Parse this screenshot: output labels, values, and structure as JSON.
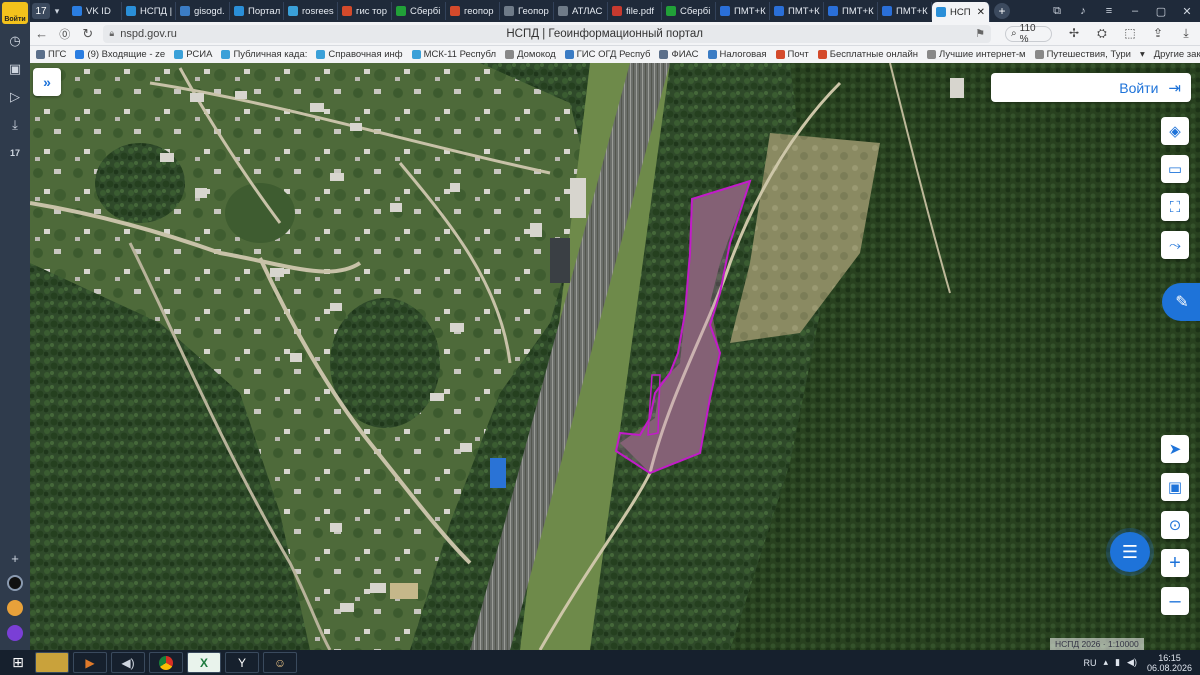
{
  "sidebar": {
    "login_label": "Войти",
    "tab_count": "17"
  },
  "tabs": [
    {
      "label": "VK ID",
      "color": "#2a7de1"
    },
    {
      "label": "НСПД |",
      "color": "#2a8fd8"
    },
    {
      "label": "gisogd.",
      "color": "#3b7cc4"
    },
    {
      "label": "Портал",
      "color": "#2a8fd8"
    },
    {
      "label": "rosrees",
      "color": "#3aa0d8"
    },
    {
      "label": "гис тор",
      "color": "#d44a2b"
    },
    {
      "label": "Сбербі",
      "color": "#21a038"
    },
    {
      "label": "геопор",
      "color": "#d44a2b"
    },
    {
      "label": "Геопор",
      "color": "#6f7b88"
    },
    {
      "label": "АТЛАС",
      "color": "#6f7b88"
    },
    {
      "label": "file.pdf",
      "color": "#c73a2f"
    },
    {
      "label": "Сбербі",
      "color": "#21a038"
    },
    {
      "label": "ПМТ+К",
      "color": "#2a6fd8"
    },
    {
      "label": "ПМТ+К",
      "color": "#2a6fd8"
    },
    {
      "label": "ПМТ+К",
      "color": "#2a6fd8"
    },
    {
      "label": "ПМТ+К",
      "color": "#2a6fd8"
    }
  ],
  "active_tab": {
    "label": "НСП",
    "close": "✕"
  },
  "address": {
    "url": "nspd.gov.ru",
    "title": "НСПД | Геоинформационный портал",
    "zoom": "110 %"
  },
  "bookmarks": [
    {
      "label": "ПГС",
      "color": "#5b6f8a"
    },
    {
      "label": "(9) Входящие - ze",
      "color": "#2a7de1"
    },
    {
      "label": "РСИА",
      "color": "#3aa0d8"
    },
    {
      "label": "Публичная када:",
      "color": "#3aa0d8"
    },
    {
      "label": "Справочная инф",
      "color": "#3aa0d8"
    },
    {
      "label": "МСК-11 Республ",
      "color": "#3aa0d8"
    },
    {
      "label": "Домокод",
      "color": "#888888"
    },
    {
      "label": "ГИС ОГД Респуб",
      "color": "#3b7cc4"
    },
    {
      "label": "ФИАС",
      "color": "#5b6f8a"
    },
    {
      "label": "Налоговая",
      "color": "#3b7cc4"
    },
    {
      "label": "Почт",
      "color": "#d44a2b"
    },
    {
      "label": "Бесплатные онлайн",
      "color": "#d44a2b"
    },
    {
      "label": "Лучшие интернет-м",
      "color": "#888888"
    },
    {
      "label": "Путешествия, Тури",
      "color": "#888888"
    }
  ],
  "bookmarks_other": "Другие закладки",
  "map": {
    "login_button": "Войти",
    "scale_text": "НСПД 2026 · 1:10000"
  },
  "taskbar": {
    "lang": "RU",
    "time": "16:15",
    "date": "06.08.2026"
  }
}
